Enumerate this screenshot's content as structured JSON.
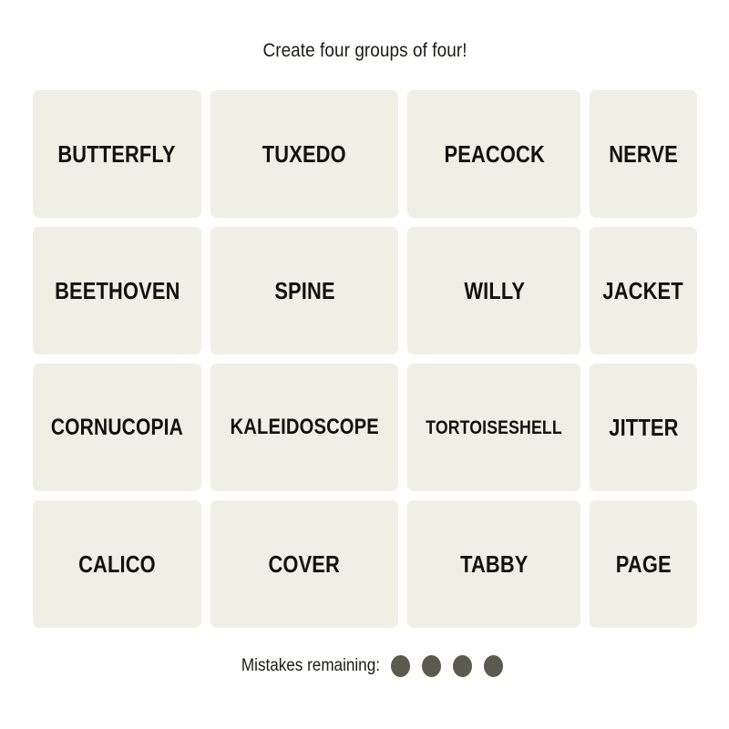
{
  "header": {
    "instruction": "Create four groups of four!"
  },
  "board": {
    "rows": 4,
    "columns": 4,
    "tiles": [
      {
        "label": "BUTTERFLY"
      },
      {
        "label": "TUXEDO"
      },
      {
        "label": "PEACOCK"
      },
      {
        "label": "NERVE"
      },
      {
        "label": "BEETHOVEN"
      },
      {
        "label": "SPINE"
      },
      {
        "label": "WILLY"
      },
      {
        "label": "JACKET"
      },
      {
        "label": "CORNUCOPIA"
      },
      {
        "label": "KALEIDOSCOPE"
      },
      {
        "label": "TORTOISESHELL"
      },
      {
        "label": "JITTER"
      },
      {
        "label": "CALICO"
      },
      {
        "label": "COVER"
      },
      {
        "label": "TABBY"
      },
      {
        "label": "PAGE"
      }
    ]
  },
  "footer": {
    "mistakes_label": "Mistakes remaining:",
    "mistakes_remaining": 4
  },
  "colors": {
    "page_background": "#ffffff",
    "tile_background": "#efefe6",
    "tile_text": "#12120c",
    "title_text": "#1b1b16",
    "mistake_dot": "#5a5a4e"
  }
}
